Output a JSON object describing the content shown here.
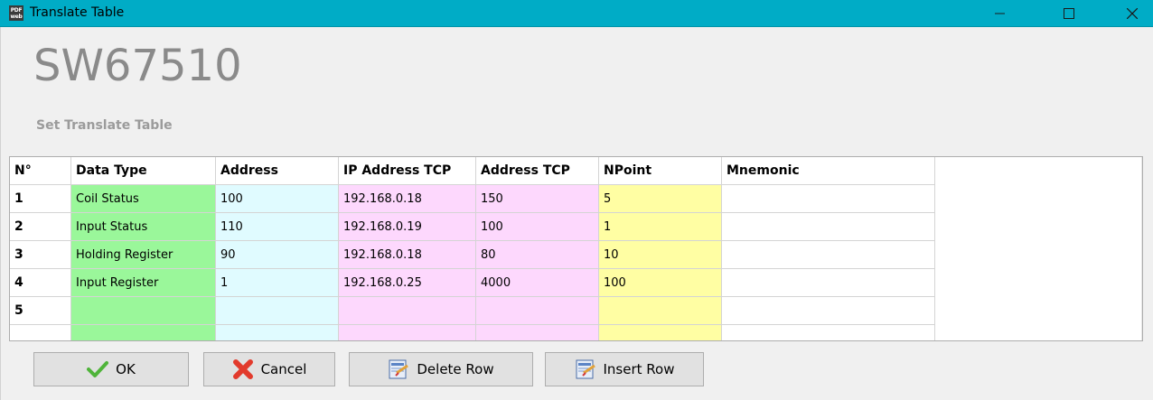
{
  "window": {
    "icon_text": "SW\nweb",
    "title": "Translate Table",
    "minimize_icon": "minimize-icon",
    "maximize_icon": "maximize-icon",
    "close_icon": "close-icon"
  },
  "header": {
    "product": "SW67510",
    "subtitle": "Set Translate Table"
  },
  "table": {
    "columns": [
      "N°",
      "Data Type",
      "Address",
      "IP Address TCP",
      "Address TCP",
      "NPoint",
      "Mnemonic"
    ],
    "rows": [
      {
        "n": "1",
        "data_type": "Coil Status",
        "address": "100",
        "ip": "192.168.0.18",
        "address_tcp": "150",
        "npoint": "5",
        "mnemonic": ""
      },
      {
        "n": "2",
        "data_type": "Input Status",
        "address": "110",
        "ip": "192.168.0.19",
        "address_tcp": "100",
        "npoint": "1",
        "mnemonic": ""
      },
      {
        "n": "3",
        "data_type": "Holding Register",
        "address": "90",
        "ip": "192.168.0.18",
        "address_tcp": "80",
        "npoint": "10",
        "mnemonic": ""
      },
      {
        "n": "4",
        "data_type": "Input Register",
        "address": "1",
        "ip": "192.168.0.25",
        "address_tcp": "4000",
        "npoint": "100",
        "mnemonic": ""
      },
      {
        "n": "5",
        "data_type": "",
        "address": "",
        "ip": "",
        "address_tcp": "",
        "npoint": "",
        "mnemonic": ""
      }
    ]
  },
  "buttons": {
    "ok": "OK",
    "cancel": "Cancel",
    "delete_row": "Delete Row",
    "insert_row": "Insert Row"
  },
  "colors": {
    "titlebar": "#00acc6",
    "data_type_cell": "#9af79a",
    "address_cell": "#e0fbff",
    "ip_cell": "#fdd8fd",
    "npoint_cell": "#fffea3"
  }
}
